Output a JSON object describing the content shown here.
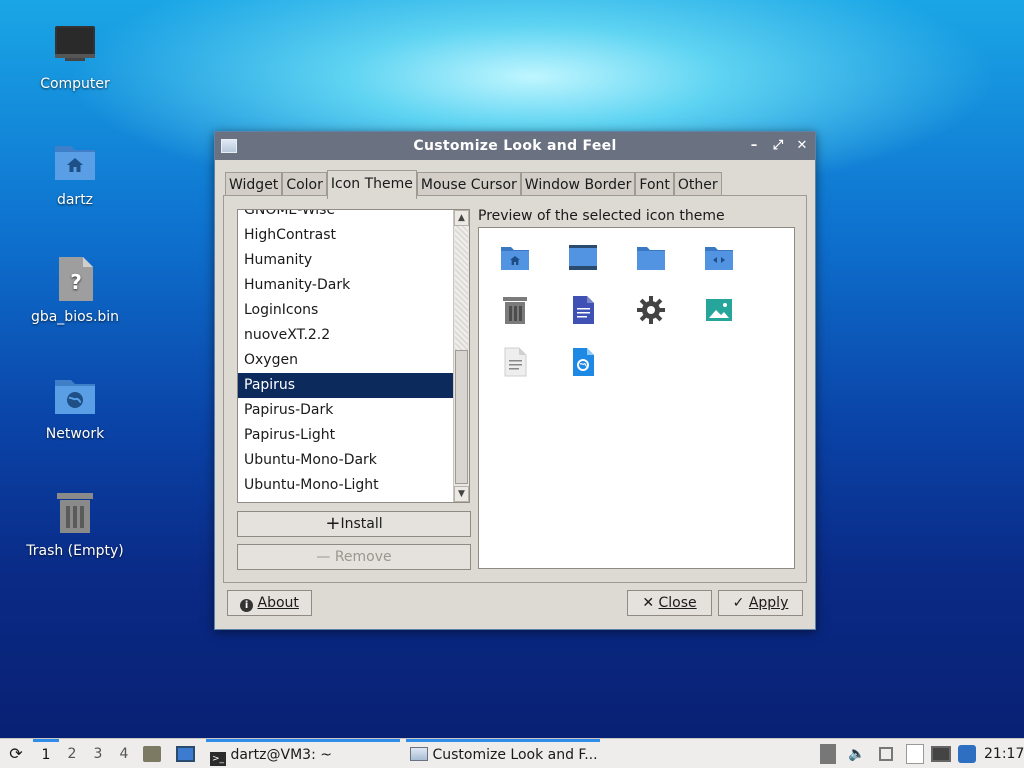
{
  "desktop": {
    "icons": [
      {
        "label": "Computer",
        "icon": "computer-icon"
      },
      {
        "label": "dartz",
        "icon": "home-folder-icon"
      },
      {
        "label": "gba_bios.bin",
        "icon": "unknown-file-icon"
      },
      {
        "label": "Network",
        "icon": "network-folder-icon"
      },
      {
        "label": "Trash (Empty)",
        "icon": "trash-icon"
      }
    ]
  },
  "window": {
    "title": "Customize Look and Feel",
    "tabs": [
      "Widget",
      "Color",
      "Icon Theme",
      "Mouse Cursor",
      "Window Border",
      "Font",
      "Other"
    ],
    "active_tab": "Icon Theme",
    "theme_list": {
      "items": [
        "GNOME-Wise",
        "HighContrast",
        "Humanity",
        "Humanity-Dark",
        "LoginIcons",
        "nuoveXT.2.2",
        "Oxygen",
        "Papirus",
        "Papirus-Dark",
        "Papirus-Light",
        "Ubuntu-Mono-Dark",
        "Ubuntu-Mono-Light"
      ],
      "selected": "Papirus"
    },
    "install_label": "Install",
    "remove_label": "Remove",
    "preview_label": "Preview of the selected icon theme",
    "preview_icons": [
      "home-folder-icon",
      "desktop-icon",
      "folder-icon",
      "remote-folder-icon",
      "trash-icon",
      "document-icon",
      "settings-gear-icon",
      "image-icon",
      "text-file-icon",
      "web-file-icon"
    ],
    "about_label": "About",
    "close_label": "Close",
    "apply_label": "Apply"
  },
  "taskbar": {
    "workspaces": [
      "1",
      "2",
      "3",
      "4"
    ],
    "active_workspace": "1",
    "tasks": [
      {
        "label": "dartz@VM3: ~",
        "icon": "terminal-icon"
      },
      {
        "label": "Customize Look and F...",
        "icon": "window-icon"
      }
    ],
    "clock": "21:17"
  },
  "colors": {
    "selection": "#0d2a5c",
    "titlebar": "#6a7180",
    "papirus_blue": "#5294e2",
    "taskbar_accent": "#2f8ce8"
  }
}
